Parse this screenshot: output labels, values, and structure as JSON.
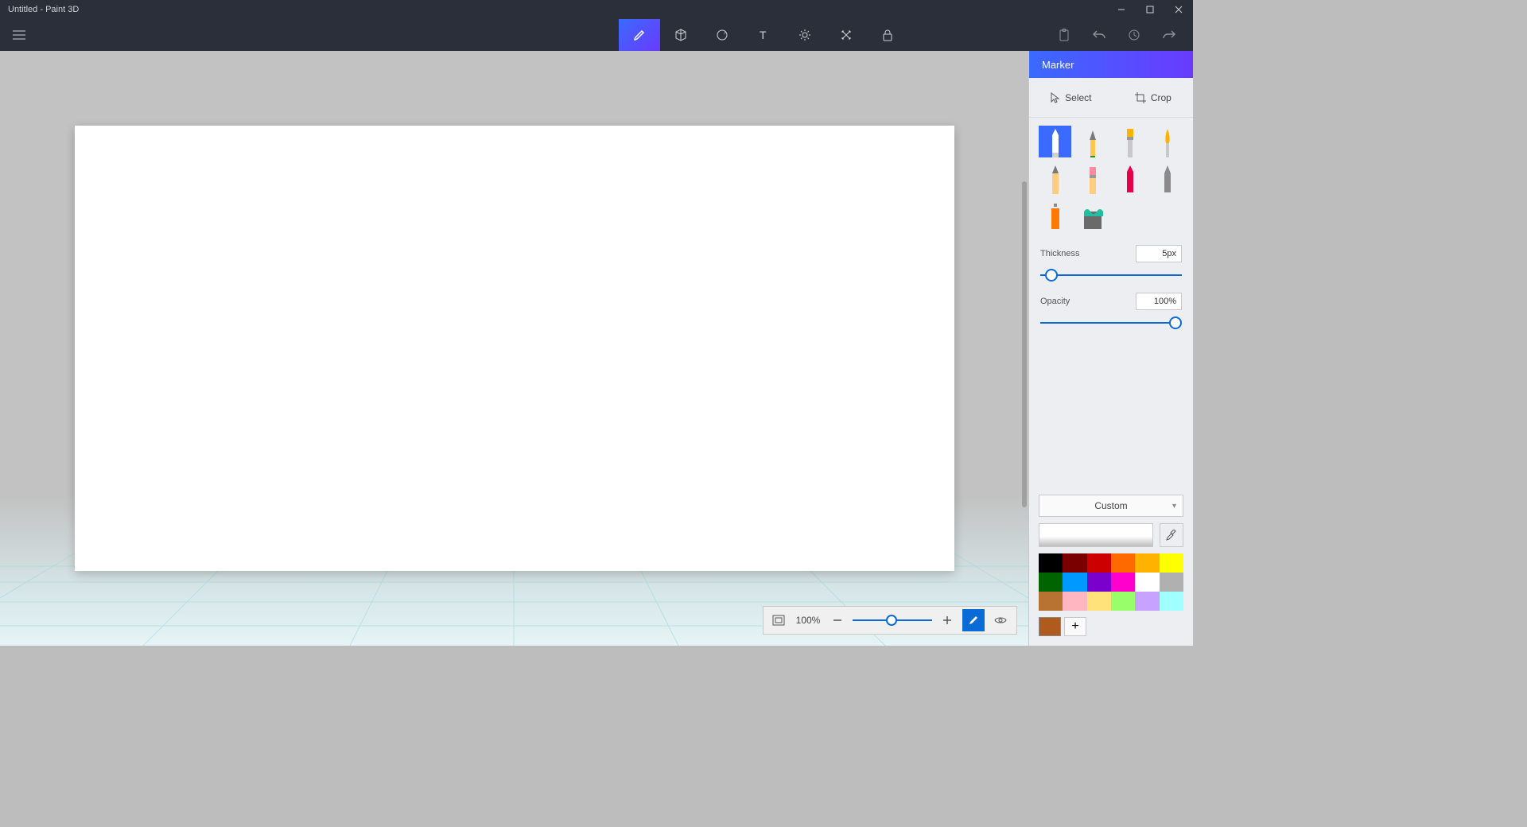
{
  "title": "Untitled - Paint 3D",
  "toolbar": {
    "tabs": [
      "brushes",
      "3d-shapes",
      "stickers",
      "text",
      "effects",
      "canvas",
      "3d-library"
    ]
  },
  "sidepanel": {
    "header": "Marker",
    "select_label": "Select",
    "crop_label": "Crop",
    "thickness_label": "Thickness",
    "thickness_value": "5px",
    "opacity_label": "Opacity",
    "opacity_value": "100%",
    "material_label": "Custom"
  },
  "zoom": {
    "percent": "100%"
  },
  "brushes": [
    "marker",
    "calligraphy-pen",
    "oil-brush",
    "watercolor",
    "pencil",
    "eraser",
    "crayon",
    "pixel-pen",
    "spray-can",
    "fill"
  ],
  "palette": [
    "#000000",
    "#7a0000",
    "#cc0000",
    "#ff6a00",
    "#ffb300",
    "#ffff00",
    "#006400",
    "#0099ff",
    "#7a00cc",
    "#ff00cc",
    "#ffffff",
    "#b0b0b0",
    "#b87333",
    "#ffb6c1",
    "#ffe27a",
    "#98ff6a",
    "#c8a2ff",
    "#a0ffff"
  ],
  "current_color": "#b05a1e"
}
